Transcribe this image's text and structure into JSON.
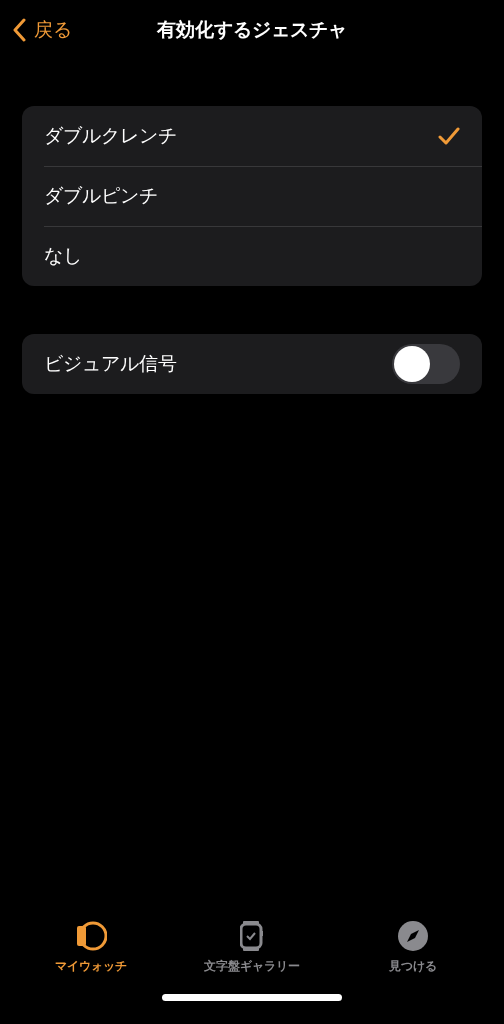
{
  "nav": {
    "back": "戻る",
    "title": "有効化するジェスチャ"
  },
  "options": [
    {
      "label": "ダブルクレンチ",
      "selected": true
    },
    {
      "label": "ダブルピンチ",
      "selected": false
    },
    {
      "label": "なし",
      "selected": false
    }
  ],
  "visual_signal": {
    "label": "ビジュアル信号",
    "on": false
  },
  "tabs": [
    {
      "kind": "watch",
      "label": "マイウォッチ",
      "selected": true
    },
    {
      "kind": "face",
      "label": "文字盤ギャラリー",
      "selected": false
    },
    {
      "kind": "discover",
      "label": "見つける",
      "selected": false
    }
  ]
}
